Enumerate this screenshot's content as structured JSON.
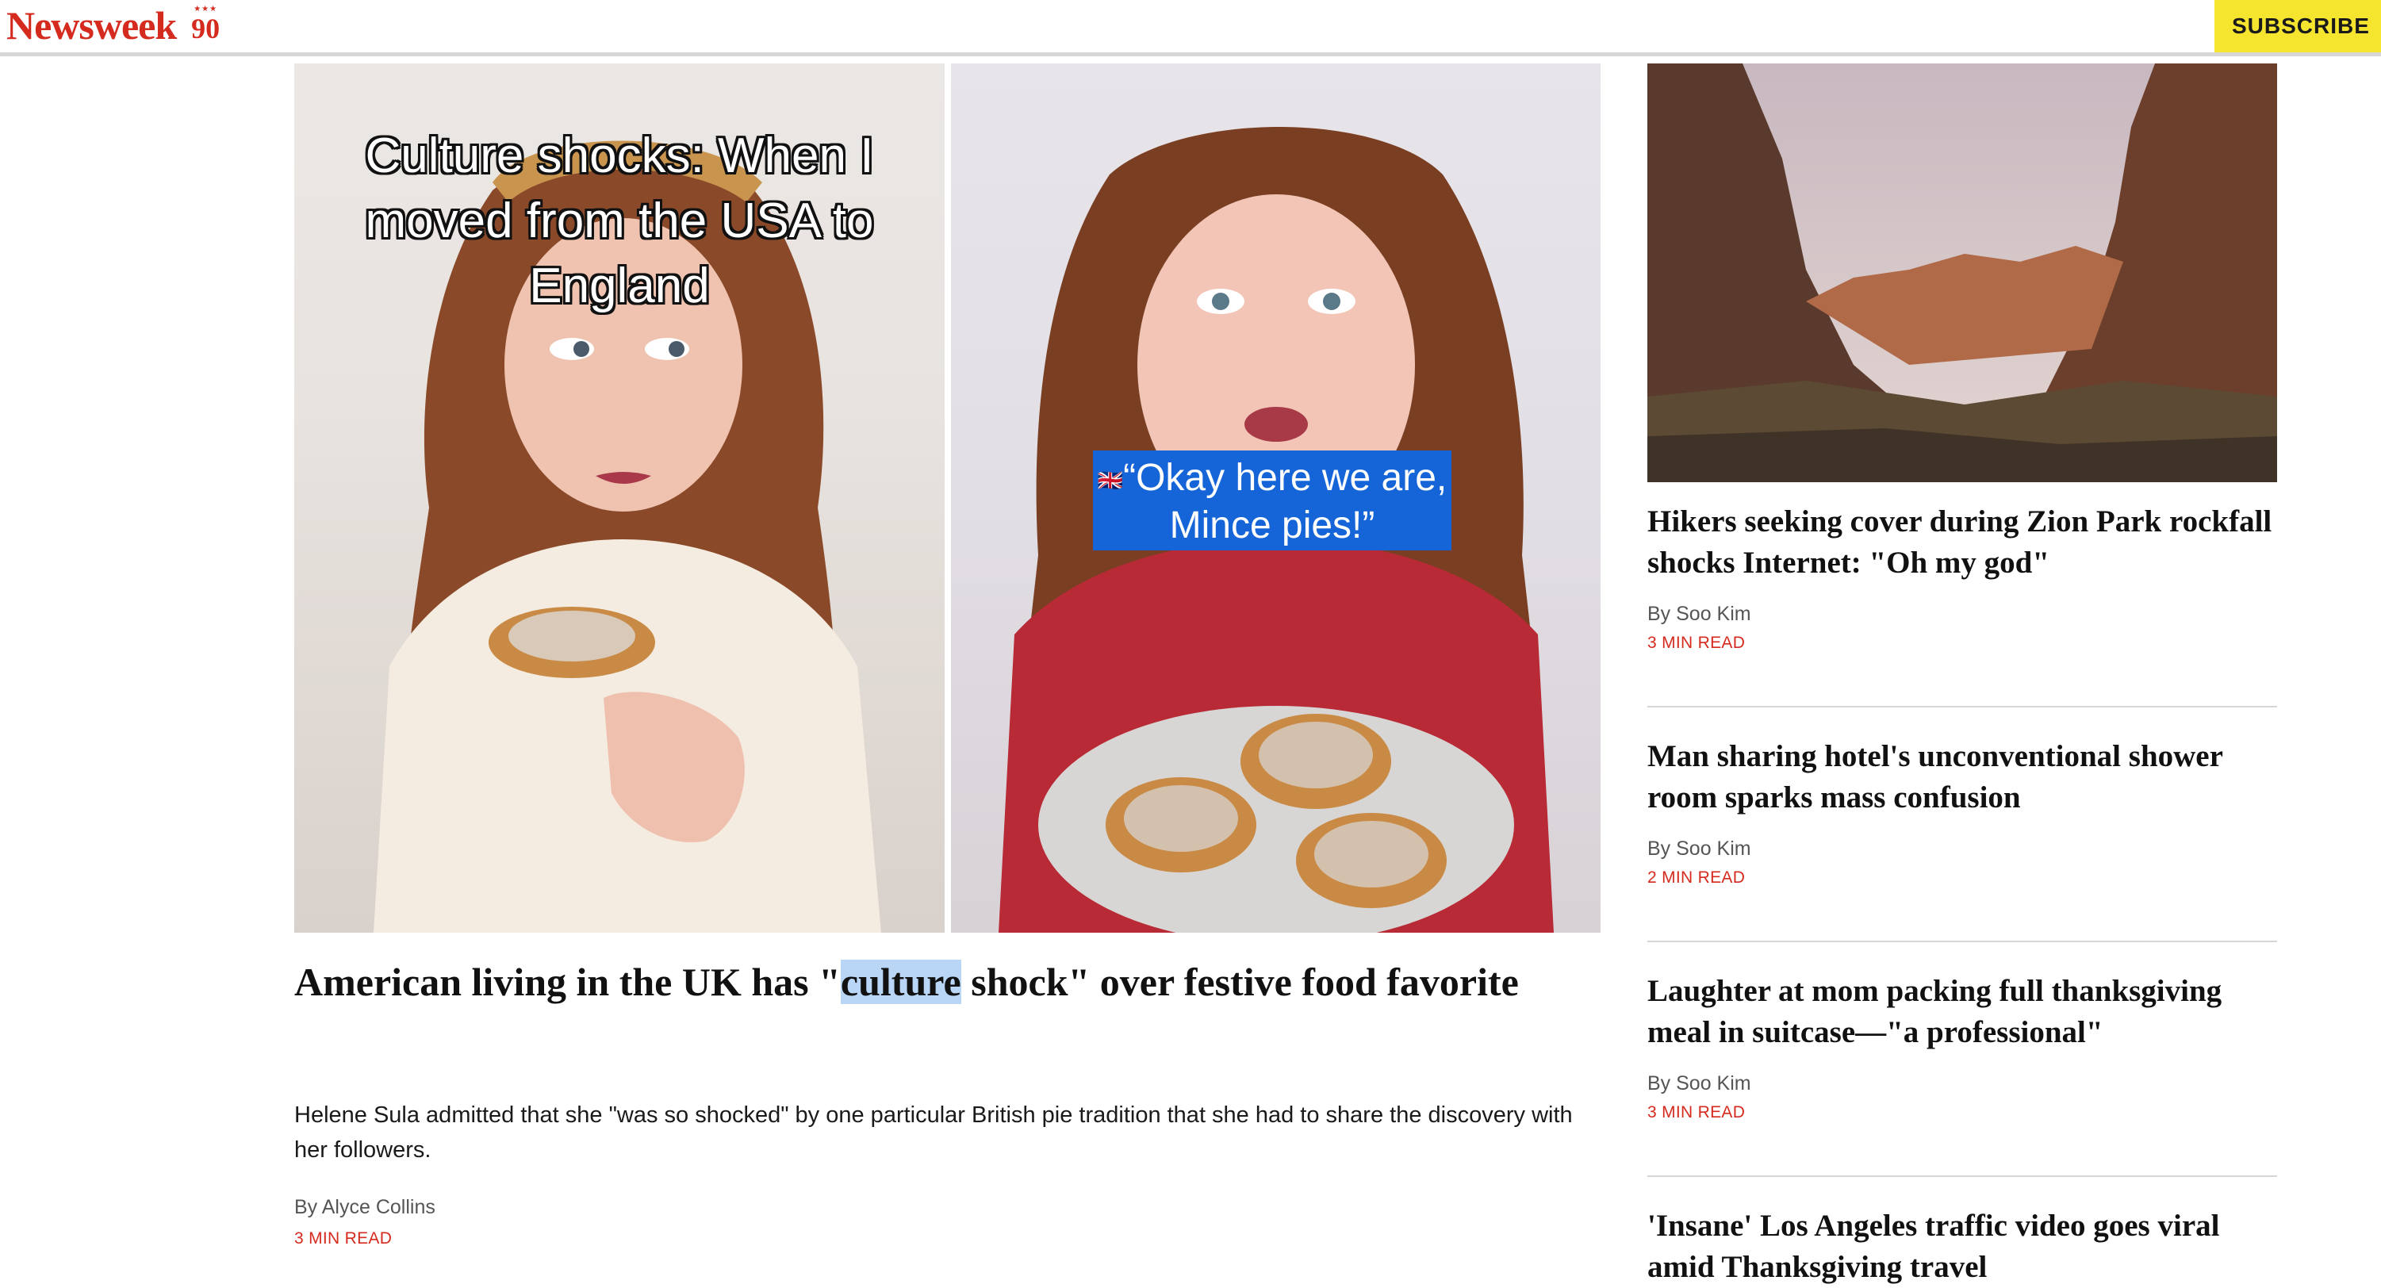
{
  "header": {
    "logo_text": "Newsweek",
    "logo_badge": "90",
    "logo_stars": "★★★",
    "subscribe_label": "SUBSCRIBE",
    "brand_color": "#d52b1e",
    "subscribe_color": "#f6e52e"
  },
  "hero": {
    "overlay_title": "Culture shocks: When I moved from the USA to England",
    "overlay_caption_flag": "🇬🇧",
    "overlay_caption": "“Okay here we are, Mince pies!”",
    "headline_before": "American living in the UK has \"",
    "headline_highlight": "culture",
    "headline_after": " shock\" over festive food favorite",
    "dek": "Helene Sula admitted that she \"was so shocked\" by one particular British pie tradition that she had to share the discovery with her followers.",
    "byline": "By Alyce Collins",
    "read_time": "3 MIN READ"
  },
  "sidebar": {
    "items": [
      {
        "title": "Hikers seeking cover during Zion Park rockfall shocks Internet: \"Oh my god\"",
        "byline": "By Soo Kim",
        "read_time": "3 MIN READ"
      },
      {
        "title": "Man sharing hotel's unconventional shower room sparks mass confusion",
        "byline": "By Soo Kim",
        "read_time": "2 MIN READ"
      },
      {
        "title": "Laughter at mom packing full thanksgiving meal in suitcase—\"a professional\"",
        "byline": "By Soo Kim",
        "read_time": "3 MIN READ"
      },
      {
        "title": "'Insane' Los Angeles traffic video goes viral amid Thanksgiving travel"
      }
    ]
  }
}
